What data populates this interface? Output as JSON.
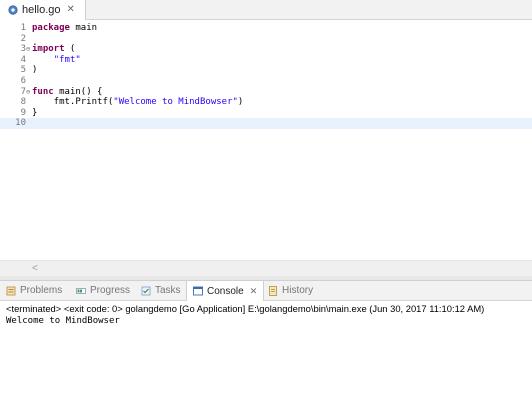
{
  "editor": {
    "tab": {
      "filename": "hello.go",
      "icon": "go-file-icon",
      "close_glyph": "✕"
    },
    "lines": [
      {
        "num": "1",
        "fold": "",
        "tokens": [
          [
            "kw",
            "package"
          ],
          [
            "plain",
            " main"
          ]
        ]
      },
      {
        "num": "2",
        "fold": "",
        "tokens": []
      },
      {
        "num": "3",
        "fold": "⊖",
        "tokens": [
          [
            "kw",
            "import"
          ],
          [
            "plain",
            " ("
          ]
        ]
      },
      {
        "num": "4",
        "fold": "",
        "tokens": [
          [
            "plain",
            "    "
          ],
          [
            "str",
            "\"fmt\""
          ]
        ]
      },
      {
        "num": "5",
        "fold": "",
        "tokens": [
          [
            "plain",
            ")"
          ]
        ]
      },
      {
        "num": "6",
        "fold": "",
        "tokens": []
      },
      {
        "num": "7",
        "fold": "⊖",
        "tokens": [
          [
            "kw",
            "func"
          ],
          [
            "plain",
            " main() {"
          ]
        ]
      },
      {
        "num": "8",
        "fold": "",
        "tokens": [
          [
            "plain",
            "    fmt.Printf("
          ],
          [
            "str",
            "\"Welcome to MindBowser\""
          ],
          [
            "plain",
            ")"
          ]
        ]
      },
      {
        "num": "9",
        "fold": "",
        "tokens": [
          [
            "plain",
            "}"
          ]
        ]
      },
      {
        "num": "10",
        "fold": "",
        "tokens": []
      }
    ],
    "current_line_index": 9,
    "scroll_left_glyph": "<"
  },
  "views": {
    "tabs": [
      {
        "label": "Problems",
        "icon": "problems-icon",
        "active": false
      },
      {
        "label": "Progress",
        "icon": "progress-icon",
        "active": false
      },
      {
        "label": "Tasks",
        "icon": "tasks-icon",
        "active": false
      },
      {
        "label": "Console",
        "icon": "console-icon",
        "active": true,
        "close_glyph": "✕"
      },
      {
        "label": "History",
        "icon": "history-icon",
        "active": false
      }
    ]
  },
  "console": {
    "status": "<terminated> <exit code: 0> golangdemo [Go Application] E:\\golangdemo\\bin\\main.exe (Jun 30, 2017 11:10:12 AM)",
    "output": "Welcome to MindBowser"
  },
  "colors": {
    "keyword": "#7f0055",
    "string": "#2a00ff",
    "line_number": "#787878",
    "current_line": "#e8f2fe"
  }
}
